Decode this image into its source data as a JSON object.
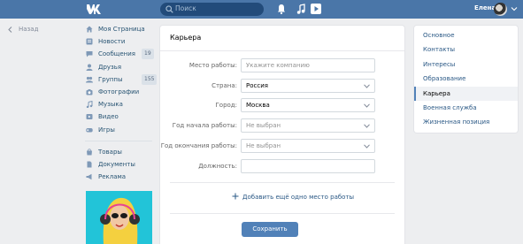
{
  "header": {
    "search_placeholder": "Поиск",
    "user_name": "Елена"
  },
  "back": {
    "label": "Назад"
  },
  "nav": {
    "items": [
      {
        "label": "Моя Страница",
        "icon": "home-icon"
      },
      {
        "label": "Новости",
        "icon": "news-icon"
      },
      {
        "label": "Сообщения",
        "icon": "messages-icon",
        "count": "19"
      },
      {
        "label": "Друзья",
        "icon": "friends-icon"
      },
      {
        "label": "Группы",
        "icon": "groups-icon",
        "count": "155"
      },
      {
        "label": "Фотографии",
        "icon": "camera-icon"
      },
      {
        "label": "Музыка",
        "icon": "music-icon"
      },
      {
        "label": "Видео",
        "icon": "video-icon"
      },
      {
        "label": "Игры",
        "icon": "games-icon"
      }
    ],
    "items2": [
      {
        "label": "Товары",
        "icon": "goods-icon"
      },
      {
        "label": "Документы",
        "icon": "documents-icon"
      },
      {
        "label": "Реклама",
        "icon": "ads-icon"
      }
    ]
  },
  "card": {
    "title": "Карьера",
    "fields": [
      {
        "label": "Место работы:",
        "value": "",
        "placeholder": "Укажите компанию",
        "dropdown": false
      },
      {
        "label": "Страна:",
        "value": "Россия",
        "placeholder": "",
        "dropdown": true
      },
      {
        "label": "Город:",
        "value": "Москва",
        "placeholder": "",
        "dropdown": true
      },
      {
        "label": "Год начала работы:",
        "value": "",
        "placeholder": "Не выбран",
        "dropdown": true
      },
      {
        "label": "Год окончания работы:",
        "value": "",
        "placeholder": "Не выбран",
        "dropdown": true
      },
      {
        "label": "Должность:",
        "value": "",
        "placeholder": "",
        "dropdown": false
      }
    ],
    "add_job": "Добавить ещё одно место работы",
    "save": "Сохранить"
  },
  "rmenu": {
    "items": [
      {
        "label": "Основное",
        "active": false
      },
      {
        "label": "Контакты",
        "active": false
      },
      {
        "label": "Интересы",
        "active": false
      },
      {
        "label": "Образование",
        "active": false
      },
      {
        "label": "Карьера",
        "active": true
      },
      {
        "label": "Военная служба",
        "active": false
      },
      {
        "label": "Жизненная позиция",
        "active": false
      }
    ]
  },
  "colors": {
    "header": "#4a76a8",
    "link": "#2a5885",
    "button": "#5181b8",
    "background": "#edeef0"
  }
}
